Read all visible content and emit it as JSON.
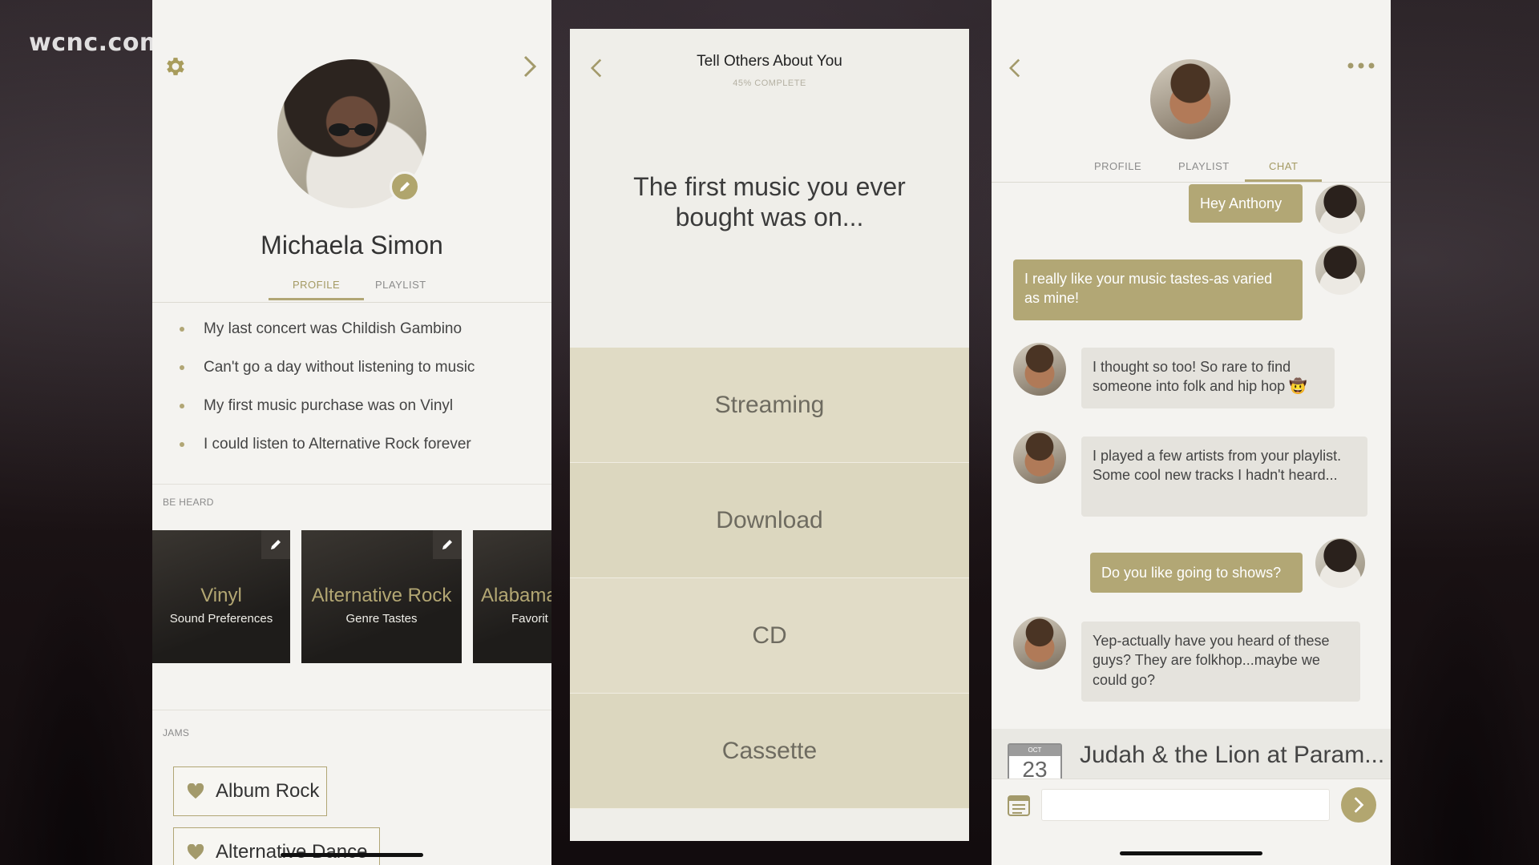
{
  "watermark": "wcnc.com",
  "colors": {
    "accent": "#b1a675",
    "panel_bg": "#f4f3f0",
    "option_bg": "#dcd7bf"
  },
  "profile_panel": {
    "name": "Michaela Simon",
    "tabs": [
      {
        "label": "PROFILE",
        "active": true
      },
      {
        "label": "PLAYLIST",
        "active": false
      }
    ],
    "facts": [
      "My last concert was Childish Gambino",
      "Can't go a day without listening to music",
      "My first music purchase was on Vinyl",
      "I could listen to Alternative Rock forever"
    ],
    "be_heard_label": "BE HEARD",
    "cards": [
      {
        "title": "Vinyl",
        "subtitle": "Sound Preferences"
      },
      {
        "title": "Alternative Rock",
        "subtitle": "Genre Tastes"
      },
      {
        "title": "Alabama",
        "subtitle": "Favorit"
      }
    ],
    "jams_label": "JAMS",
    "jams": [
      "Album Rock",
      "Alternative Dance"
    ]
  },
  "question_panel": {
    "title": "Tell Others About You",
    "progress_label": "45% COMPLETE",
    "progress": 45,
    "question": "The first music you ever bought was on...",
    "options": [
      "Streaming",
      "Download",
      "CD",
      "Cassette"
    ]
  },
  "chat_panel": {
    "tabs": [
      {
        "label": "PROFILE",
        "active": false
      },
      {
        "label": "PLAYLIST",
        "active": false
      },
      {
        "label": "CHAT",
        "active": true
      }
    ],
    "messages": [
      {
        "from": "me",
        "text": "Hey Anthony"
      },
      {
        "from": "me",
        "text": "I really like your music tastes-as varied as mine!"
      },
      {
        "from": "them",
        "text": "I thought so too! So rare to find someone into folk and hip hop 🤠"
      },
      {
        "from": "them",
        "text": "I played a few artists from your playlist. Some cool new tracks I hadn't heard..."
      },
      {
        "from": "me",
        "text": "Do you like going to shows?"
      },
      {
        "from": "them",
        "text": "Yep-actually have you heard of these guys? They are folkhop...maybe we could  go?"
      }
    ],
    "event": {
      "month": "OCT",
      "day": "23",
      "title": "Judah & the Lion at Param..."
    },
    "composer": {
      "placeholder": ""
    }
  }
}
